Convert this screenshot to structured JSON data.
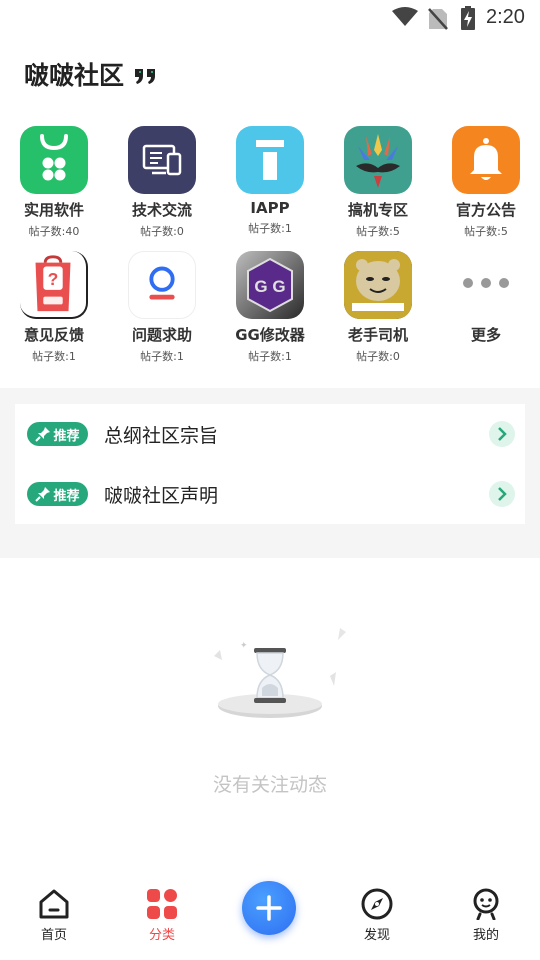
{
  "status_bar": {
    "time": "2:20",
    "icons": [
      "wifi-icon",
      "no-sim-icon",
      "battery-charging-icon"
    ]
  },
  "header": {
    "title": "啵啵社区",
    "icon": "quote-icon"
  },
  "categories": [
    {
      "label": "实用软件",
      "count": "帖子数:40",
      "icon": "shopping-bag-icon",
      "color": "#27c06a"
    },
    {
      "label": "技术交流",
      "count": "帖子数:0",
      "icon": "computer-icon",
      "color": "#3d3f66"
    },
    {
      "label": "IAPP",
      "count": "帖子数:1",
      "icon": "iapp-logo-icon",
      "color": "#4ec6ea"
    },
    {
      "label": "搞机专区",
      "count": "帖子数:5",
      "icon": "magisk-mask-icon",
      "color": "#3fa08f"
    },
    {
      "label": "官方公告",
      "count": "帖子数:5",
      "icon": "bell-icon",
      "color": "#f5861f"
    },
    {
      "label": "意见反馈",
      "count": "帖子数:1",
      "icon": "feedback-bag-icon",
      "color": "#e94f4f"
    },
    {
      "label": "问题求助",
      "count": "帖子数:1",
      "icon": "help-person-icon",
      "color": "#2f6ef2"
    },
    {
      "label": "GG修改器",
      "count": "帖子数:1",
      "icon": "gg-logo-icon",
      "color": "#6b2fa3"
    },
    {
      "label": "老手司机",
      "count": "帖子数:0",
      "icon": "meme-face-icon",
      "color": "#c9a832"
    },
    {
      "label": "更多",
      "count": "",
      "icon": "more-dots-icon",
      "color": "#999999"
    }
  ],
  "pinned": {
    "badge_label": "推荐",
    "items": [
      {
        "title": "总纲社区宗旨"
      },
      {
        "title": "啵啵社区声明"
      }
    ]
  },
  "empty_state": {
    "text": "没有关注动态"
  },
  "bottom_nav": {
    "items": [
      {
        "label": "首页",
        "icon": "home-icon"
      },
      {
        "label": "分类",
        "icon": "category-grid-icon",
        "active": true
      },
      {
        "label": "发现",
        "icon": "compass-icon"
      },
      {
        "label": "我的",
        "icon": "profile-icon"
      }
    ],
    "fab_icon": "plus-icon"
  },
  "colors": {
    "accent_green": "#27a87c",
    "active_nav": "#ee4a4a",
    "fab_blue": "#2f6ef2"
  }
}
